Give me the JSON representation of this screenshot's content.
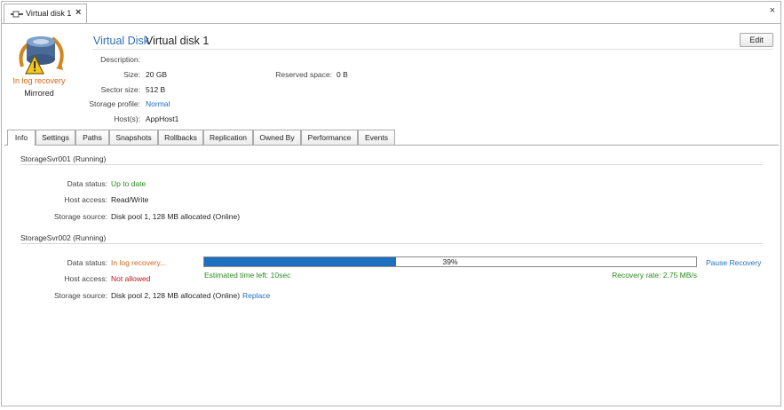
{
  "document_tab": {
    "label": "Virtual disk 1",
    "close": "×",
    "icon": "virtual-disk-icon"
  },
  "window": {
    "close": "×"
  },
  "header": {
    "type_label": "Virtual Disk",
    "name": "Virtual disk 1",
    "edit_label": "Edit",
    "status": "In log recovery",
    "mode": "Mirrored",
    "icon": "disk-warning-icon"
  },
  "properties": {
    "description": {
      "label": "Description:",
      "value": ""
    },
    "size": {
      "label": "Size:",
      "value": "20 GB"
    },
    "sector_size": {
      "label": "Sector size:",
      "value": "512 B"
    },
    "storage_profile": {
      "label": "Storage profile:",
      "value": "Normal"
    },
    "hosts": {
      "label": "Host(s):",
      "value": "AppHost1"
    },
    "reserved_space": {
      "label": "Reserved space:",
      "value": "0 B"
    }
  },
  "tabs": [
    "Info",
    "Settings",
    "Paths",
    "Snapshots",
    "Rollbacks",
    "Replication",
    "Owned By",
    "Performance",
    "Events"
  ],
  "server1": {
    "title": "StorageSvr001 (Running)",
    "data_status_label": "Data status:",
    "data_status": "Up to date",
    "host_access_label": "Host access:",
    "host_access": "Read/Write",
    "storage_source_label": "Storage source:",
    "storage_source": "Disk pool 1, 128 MB allocated (Online)"
  },
  "server2": {
    "title": "StorageSvr002 (Running)",
    "data_status_label": "Data status:",
    "data_status": "In log recovery...",
    "host_access_label": "Host access:",
    "host_access": "Not allowed",
    "storage_source_label": "Storage source:",
    "storage_source": "Disk pool 2, 128 MB allocated (Online)",
    "replace_label": "Replace",
    "progress_percent": 39,
    "progress_text": "39%",
    "estimated_time": "Estimated time left: 10sec",
    "recovery_rate": "Recovery rate: 2.75 MB/s",
    "pause_label": "Pause Recovery"
  },
  "colors": {
    "link": "#1f6fc5",
    "ok": "#2a8c1e",
    "warning": "#d2691e",
    "error": "#c01818",
    "progress": "#1d6fc0"
  }
}
